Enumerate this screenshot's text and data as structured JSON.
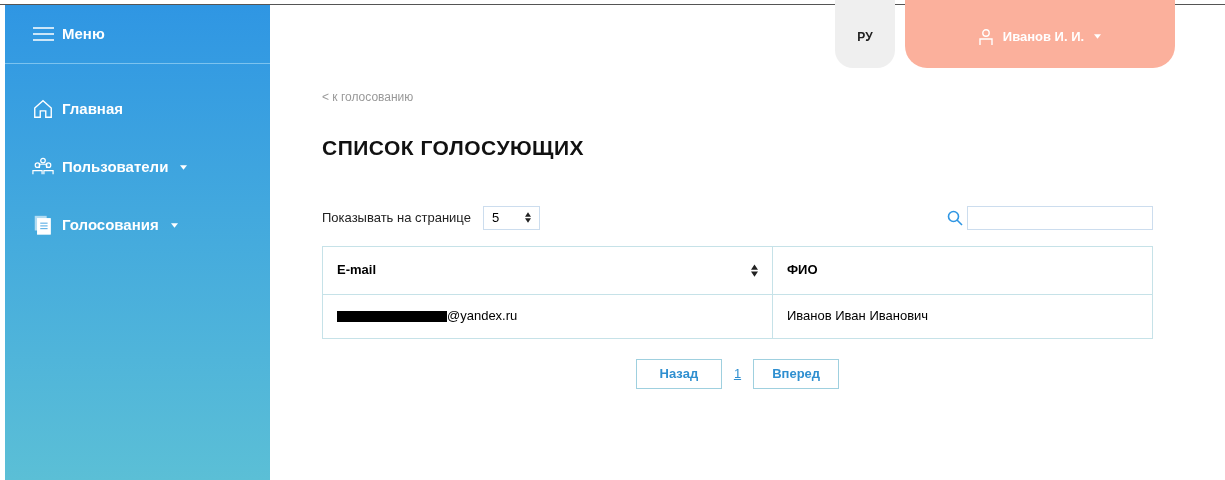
{
  "sidebar": {
    "menu_label": "Меню",
    "items": [
      {
        "kind": "home",
        "label": "Главная",
        "has_dropdown": false
      },
      {
        "kind": "users",
        "label": "Пользователи",
        "has_dropdown": true
      },
      {
        "kind": "documents",
        "label": "Голосования",
        "has_dropdown": true
      }
    ]
  },
  "header": {
    "language": "РУ",
    "user": "Иванов И. И."
  },
  "back_link": "< к голосованию",
  "title": "СПИСОК ГОЛОСУЮЩИХ",
  "page_size": {
    "label": "Показывать на странице",
    "value": "5"
  },
  "table": {
    "columns": [
      {
        "label": "E-mail",
        "sortable": true
      },
      {
        "label": "ФИО",
        "sortable": false
      }
    ],
    "rows": [
      {
        "email": "@yandex.ru",
        "email_redacted": true,
        "name": "Иванов Иван Иванович"
      }
    ]
  },
  "pagination": {
    "prev": "Назад",
    "pages": [
      {
        "label": "1",
        "selected": false
      }
    ],
    "next": "Вперед"
  }
}
